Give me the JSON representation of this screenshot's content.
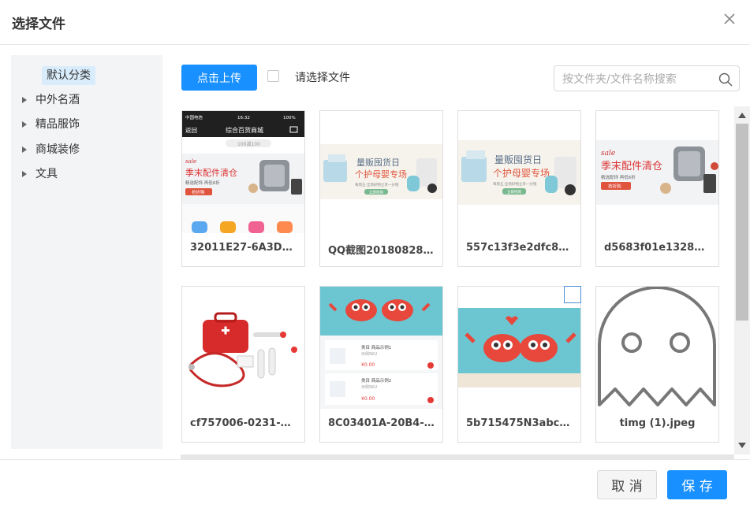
{
  "dialog": {
    "title": "选择文件",
    "close_icon": "close-icon"
  },
  "sidebar": {
    "selected": "默认分类",
    "items": [
      {
        "label": "中外名酒"
      },
      {
        "label": "精品服饰"
      },
      {
        "label": "商城装修"
      },
      {
        "label": "文具"
      }
    ]
  },
  "toolbar": {
    "upload_label": "点击上传",
    "select_label": "请选择文件",
    "search_placeholder": "按文件夹/文件名称搜索",
    "search_icon": "search-icon"
  },
  "files": [
    {
      "name": "32011E27-6A3D-4..."
    },
    {
      "name": "QQ截图201808281..."
    },
    {
      "name": "557c13f3e2dfc867..."
    },
    {
      "name": "d5683f01e1328512..."
    },
    {
      "name": "cf757006-0231-4d..."
    },
    {
      "name": "8C03401A-20B4-4..."
    },
    {
      "name": "5b715475N3abcf7..."
    },
    {
      "name": "timg (1).jpeg"
    }
  ],
  "thumb_text": {
    "phone_status": "中国电信",
    "phone_time": "16:32",
    "phone_battery": "100%",
    "phone_back": "返回",
    "phone_title": "综合百货商城",
    "phone_search": "100减100",
    "sale": "sale",
    "sale_title": "季末配件清仓",
    "sale_sub": "精选配饰 再低6折",
    "sale_btn": "抢折购",
    "baby_title": "量贩囤货日",
    "baby_sub": "个护母婴专场",
    "baby_tag": "每周五·全场好物立享一分钱",
    "baby_btn": "立即抢购",
    "list_item1": "类目 商品示例1",
    "list_item2": "类目 商品示例2",
    "list_sku": "示例SKU",
    "list_price": "¥0.00"
  },
  "footer": {
    "cancel_label": "取 消",
    "save_label": "保 存"
  },
  "colors": {
    "primary": "#1890ff",
    "sidebar_bg": "#f3f4f6",
    "selected_bg": "#d9ecfb"
  }
}
